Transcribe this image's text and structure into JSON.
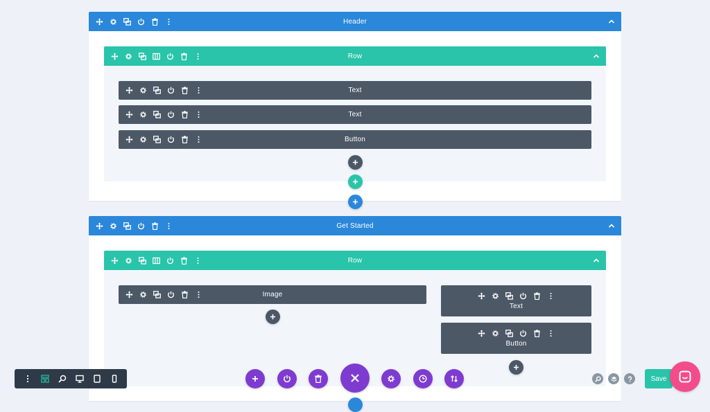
{
  "sections": [
    {
      "title": "Header",
      "row_title": "Row",
      "modules": [
        "Text",
        "Text",
        "Button"
      ]
    },
    {
      "title": "Get Started",
      "row_title": "Row",
      "left_modules": [
        "Image"
      ],
      "right_modules": [
        "Text",
        "Button"
      ]
    }
  ],
  "bottom_bar": {
    "save_label": "Save"
  },
  "colors": {
    "section": "#2b87da",
    "row": "#29c4a9",
    "module": "#4c5866",
    "purple": "#7e3bd0",
    "background": "#eef2f8",
    "save": "#29c4a9",
    "chat": "#f34c8a"
  }
}
